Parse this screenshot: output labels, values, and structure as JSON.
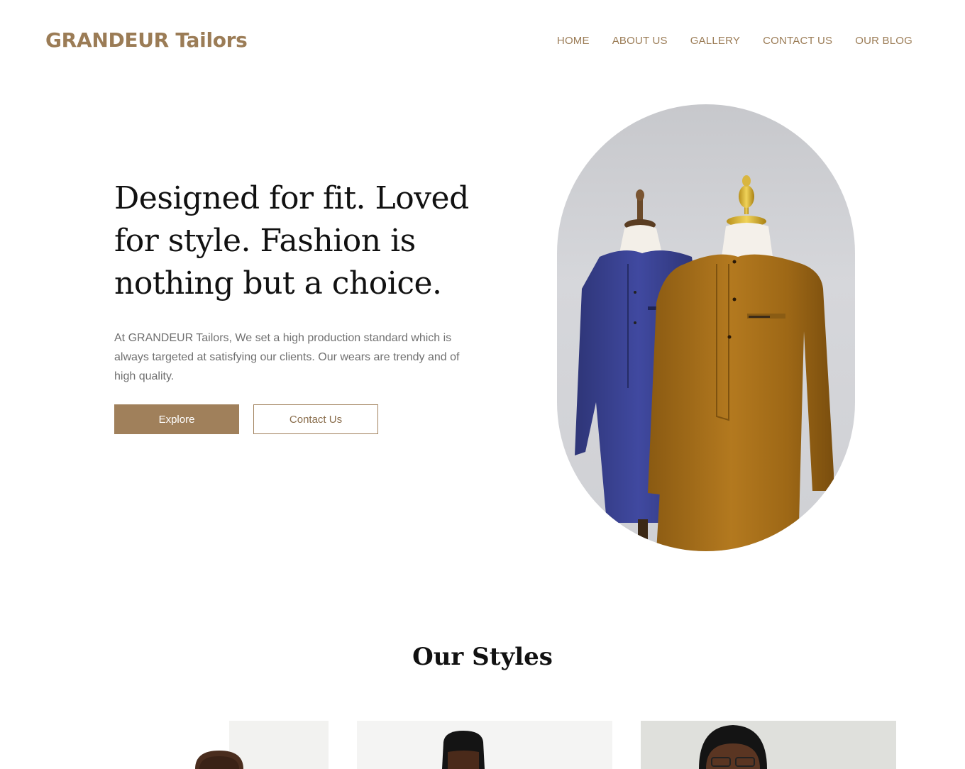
{
  "brand": {
    "name": "GRANDEUR Tailors",
    "color": "#9b7c56"
  },
  "nav": {
    "items": [
      {
        "label": "HOME"
      },
      {
        "label": "ABOUT US"
      },
      {
        "label": "GALLERY"
      },
      {
        "label": "CONTACT US"
      },
      {
        "label": "OUR BLOG"
      }
    ]
  },
  "hero": {
    "title": "Designed for fit. Loved for style. Fashion is nothing but a choice.",
    "description": "At GRANDEUR Tailors, We set a high production standard which is always targeted at satisfying our clients. Our wears are trendy and of high quality.",
    "primary_button": "Explore",
    "secondary_button": "Contact Us",
    "image": "two-mannequins-kaftans-navy-and-brown"
  },
  "styles_section": {
    "title": "Our Styles",
    "cards": [
      {
        "image": "man-portrait-white-background"
      },
      {
        "image": "man-portrait-high-top-haircut"
      },
      {
        "image": "man-portrait-glasses"
      }
    ]
  },
  "colors": {
    "accent": "#a0805b",
    "text": "#111111",
    "muted": "#707070"
  }
}
